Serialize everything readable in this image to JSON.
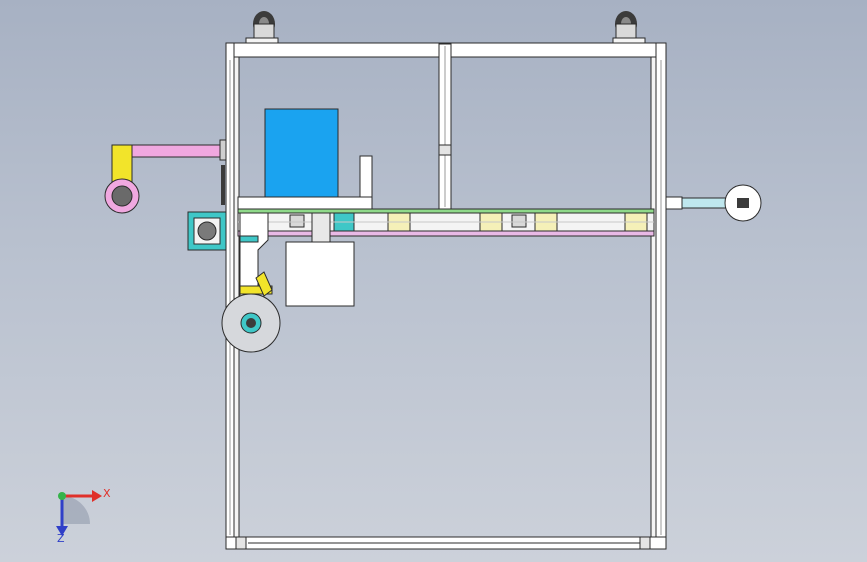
{
  "viewport": {
    "background_top": "#a7b1c3",
    "background_bottom": "#ccd1da"
  },
  "triad": {
    "x_label": "X",
    "z_label": "Z",
    "x_color": "#e0302a",
    "y_color": "#35b34a",
    "z_color": "#2f3fc8"
  },
  "colors": {
    "frame": "#ffffff",
    "frame_edge": "#2b2b2b",
    "motor_blue": "#1aa3f0",
    "arm_pink": "#f0a8e0",
    "bracket_yellow": "#f2e42a",
    "block_cream": "#f5f0b8",
    "plate_green": "#8fd98a",
    "rail_pink": "#e9b9e6",
    "rod_cyan": "#bfe7ee",
    "bracket_teal": "#3fc7c7",
    "box_white": "#ffffff"
  }
}
